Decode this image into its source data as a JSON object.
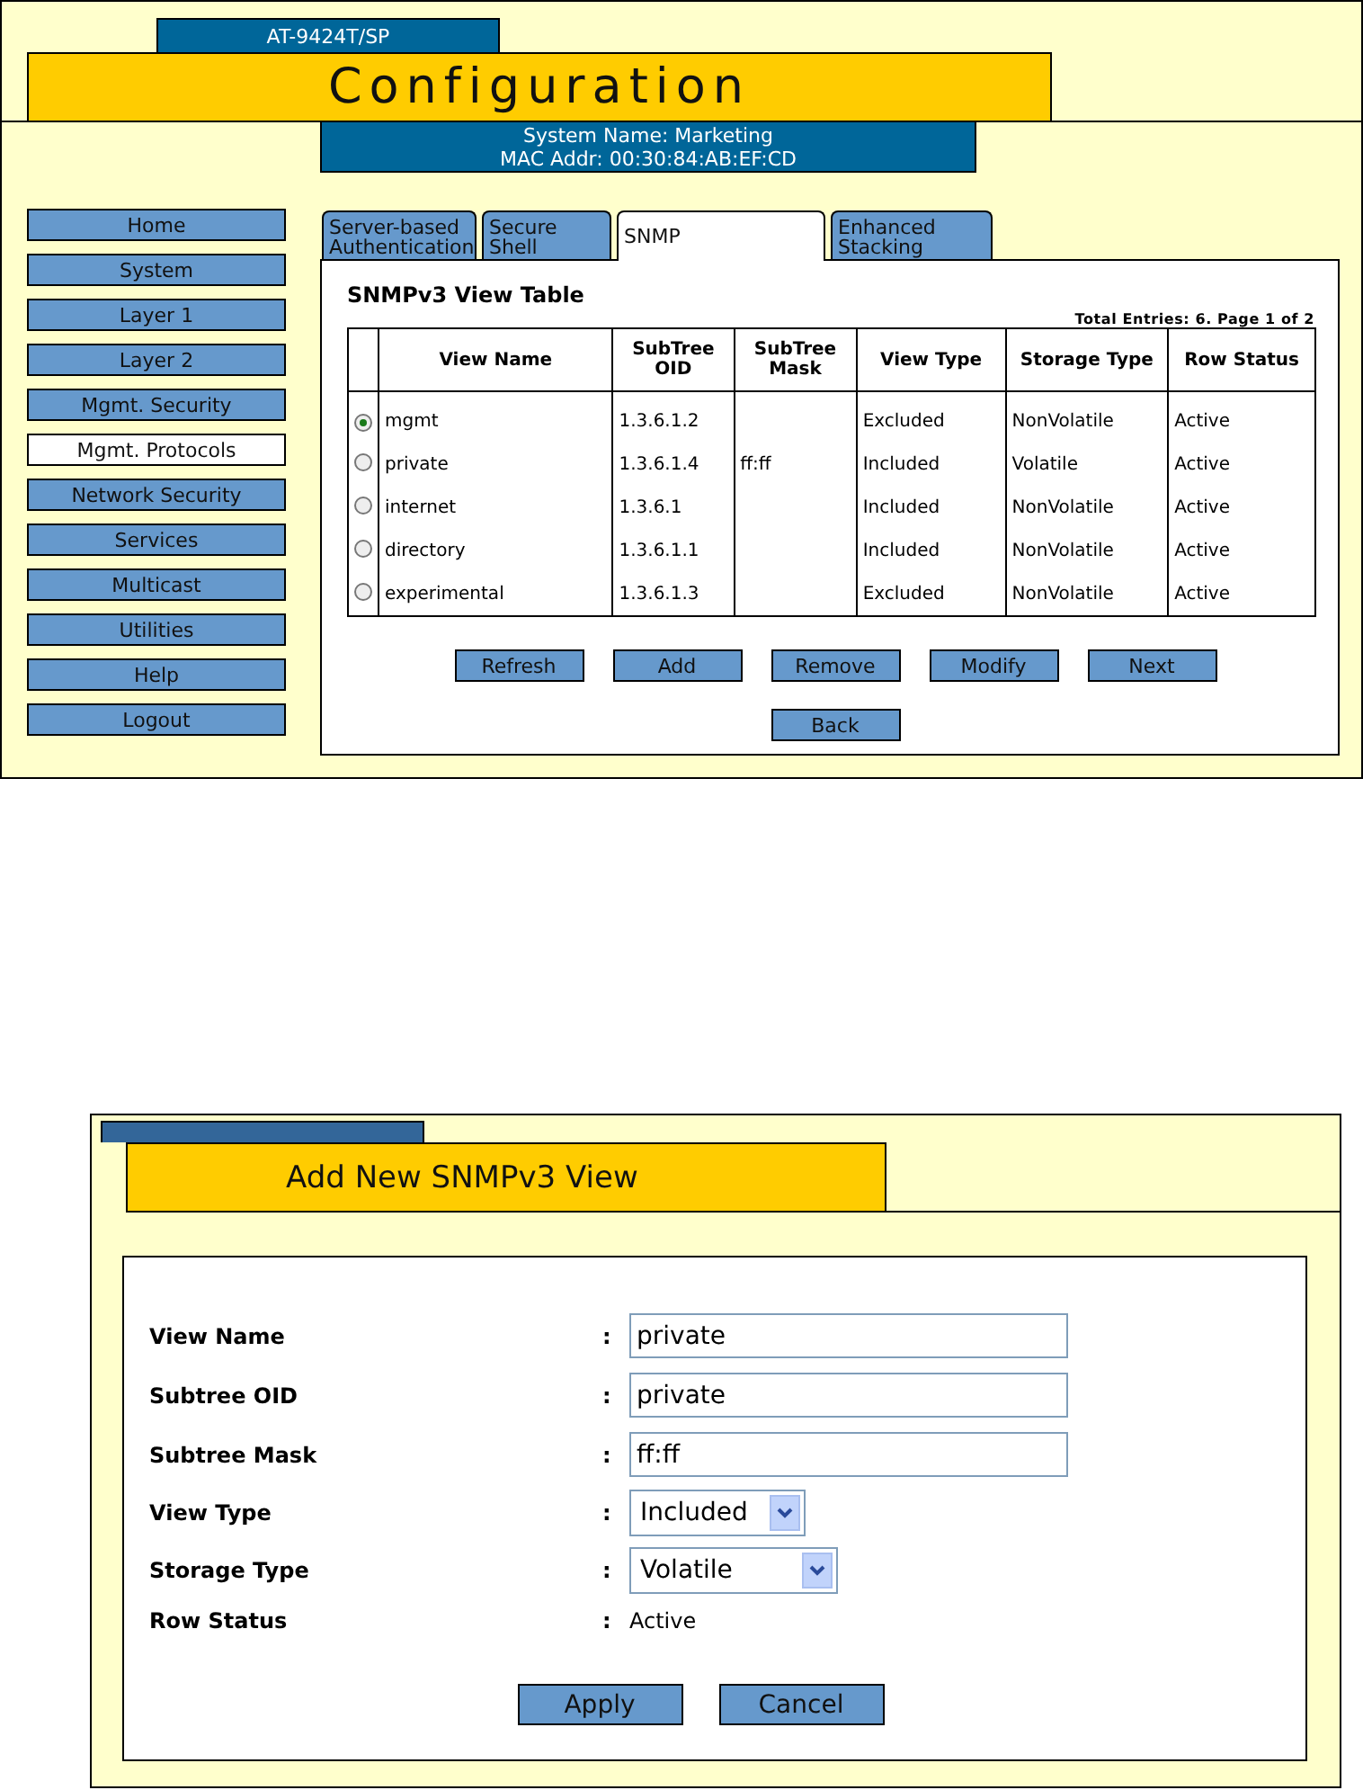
{
  "header": {
    "model": "AT-9424T/SP",
    "title": "Configuration",
    "system_name": "System Name: Marketing",
    "mac_addr": "MAC Addr: 00:30:84:AB:EF:CD"
  },
  "sidebar": {
    "items": [
      {
        "label": "Home",
        "selected": false
      },
      {
        "label": "System",
        "selected": false
      },
      {
        "label": "Layer 1",
        "selected": false
      },
      {
        "label": "Layer 2",
        "selected": false
      },
      {
        "label": "Mgmt. Security",
        "selected": false
      },
      {
        "label": "Mgmt. Protocols",
        "selected": true
      },
      {
        "label": "Network Security",
        "selected": false
      },
      {
        "label": "Services",
        "selected": false
      },
      {
        "label": "Multicast",
        "selected": false
      },
      {
        "label": "Utilities",
        "selected": false
      },
      {
        "label": "Help",
        "selected": false
      },
      {
        "label": "Logout",
        "selected": false
      }
    ]
  },
  "tabs": [
    {
      "label": "Server-based Authentication",
      "selected": false
    },
    {
      "label": "Secure Shell",
      "selected": false
    },
    {
      "label": "SNMP",
      "selected": true
    },
    {
      "label": "Enhanced Stacking",
      "selected": false
    }
  ],
  "view_table": {
    "title": "SNMPv3 View Table",
    "summary": "Total Entries: 6. Page 1 of 2",
    "columns": [
      "View Name",
      "SubTree OID",
      "SubTree Mask",
      "View Type",
      "Storage Type",
      "Row Status"
    ],
    "rows": [
      {
        "selected": true,
        "view_name": "mgmt",
        "subtree_oid": "1.3.6.1.2",
        "view_type": "Excluded",
        "storage_type": "NonVolatile",
        "row_status": "Active"
      },
      {
        "selected": false,
        "view_name": "private",
        "subtree_oid": "1.3.6.1.4",
        "subtree_mask": "ff:ff",
        "view_type": "Included",
        "storage_type": "Volatile",
        "row_status": "Active"
      },
      {
        "selected": false,
        "view_name": "internet",
        "subtree_oid": "1.3.6.1",
        "view_type": "Included",
        "storage_type": "NonVolatile",
        "row_status": "Active"
      },
      {
        "selected": false,
        "view_name": "directory",
        "subtree_oid": "1.3.6.1.1",
        "view_type": "Included",
        "storage_type": "NonVolatile",
        "row_status": "Active"
      },
      {
        "selected": false,
        "view_name": "experimental",
        "subtree_oid": "1.3.6.1.3",
        "view_type": "Excluded",
        "storage_type": "NonVolatile",
        "row_status": "Active"
      }
    ],
    "buttons": [
      "Refresh",
      "Add",
      "Remove",
      "Modify",
      "Next"
    ],
    "back_button": "Back"
  },
  "add_form": {
    "title": "Add New SNMPv3 View",
    "fields": [
      {
        "kind": "text",
        "label": "View Name",
        "separator": ":",
        "value": "private"
      },
      {
        "kind": "text",
        "label": "Subtree OID",
        "separator": ":",
        "value": "private"
      },
      {
        "kind": "text",
        "label": "Subtree Mask",
        "separator": ":",
        "value": "ff:ff"
      },
      {
        "kind": "select",
        "label": "View Type",
        "separator": ":",
        "value": "Included"
      },
      {
        "kind": "select",
        "label": "Storage Type",
        "separator": ":",
        "value": "Volatile"
      },
      {
        "kind": "static",
        "label": "Row Status",
        "separator": ":",
        "value": "Active"
      }
    ],
    "buttons": [
      "Apply",
      "Cancel"
    ]
  }
}
